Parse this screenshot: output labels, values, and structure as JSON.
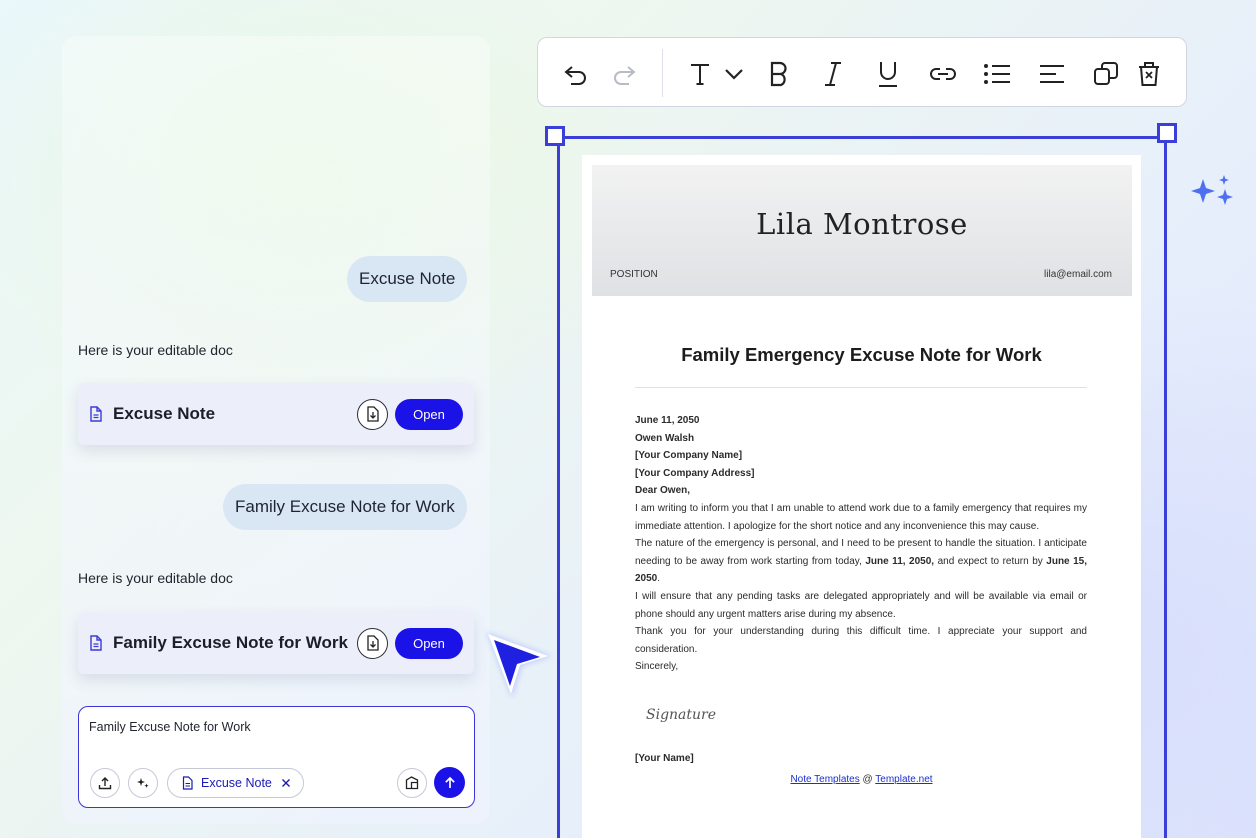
{
  "chat": {
    "messages": [
      {
        "role": "user",
        "text": "Excuse Note"
      },
      {
        "role": "assistant",
        "text": "Here is your editable doc",
        "doc_title": "Excuse Note",
        "open_label": "Open"
      },
      {
        "role": "user",
        "text": "Family Excuse Note for Work"
      },
      {
        "role": "assistant",
        "text": "Here is your editable doc",
        "doc_title": "Family Excuse Note for Work",
        "open_label": "Open"
      }
    ],
    "input": {
      "value": "Family Excuse Note for Work",
      "chip_label": "Excuse Note"
    }
  },
  "toolbar": {
    "icons": [
      "undo-icon",
      "redo-icon",
      "text-style-icon",
      "chevron-down-icon",
      "bold-icon",
      "italic-icon",
      "underline-icon",
      "link-icon",
      "list-icon",
      "align-icon",
      "duplicate-icon",
      "delete-icon"
    ]
  },
  "document": {
    "header": {
      "name": "Lila Montrose",
      "position": "POSITION",
      "email": "lila@email.com"
    },
    "title": "Family Emergency Excuse Note for Work",
    "date": "June 11, 2050",
    "recipient": "Owen Walsh",
    "company_name": "[Your Company Name]",
    "company_address": "[Your Company Address]",
    "salutation": "Dear Owen,",
    "para1": "I am writing to inform you that I am unable to attend work due to a family emergency that requires my immediate attention. I apologize for the short notice and any inconvenience this may cause.",
    "para2_a": "The nature of the emergency is personal, and I need to be present to handle the situation. I anticipate needing to be away from work starting from today,",
    "para2_date1": "June 11, 2050,",
    "para2_b": "and expect to return by",
    "para2_date2": "June 15, 2050",
    "para2_c": ".",
    "para3": "I will ensure that any pending tasks are delegated appropriately and will be available via email or phone should any urgent matters arise during my absence.",
    "para4": "Thank you for your understanding during this difficult time. I appreciate your support and consideration.",
    "closing": "Sincerely,",
    "signature": "Signature",
    "your_name": "[Your Name]",
    "footer_link1": "Note Templates",
    "footer_sep": "@",
    "footer_link2": "Template.net"
  },
  "colors": {
    "accent": "#1a12e6",
    "selection": "#3b3fd9",
    "sparkle": "#4d6ff0"
  }
}
